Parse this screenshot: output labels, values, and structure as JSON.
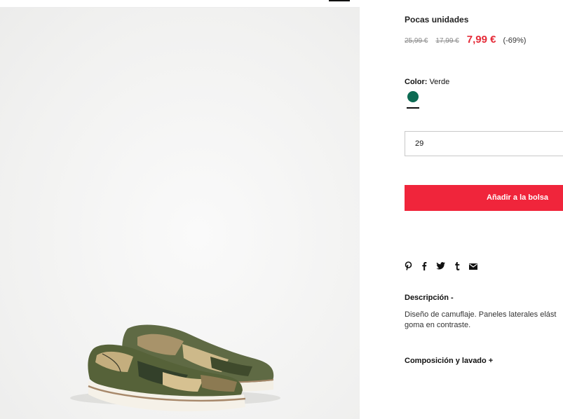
{
  "product": {
    "stock_label": "Pocas unidades",
    "prices": {
      "original": "25,99 €",
      "previous": "17,99 €",
      "current": "7,99 €",
      "discount": "(-69%)"
    },
    "color": {
      "label": "Color:",
      "value": "Verde",
      "swatch_hex": "#0d6b53"
    },
    "size": {
      "selected": "29"
    },
    "add_to_bag_label": "Añadir a la bolsa",
    "share_icons": [
      "pinterest-icon",
      "facebook-icon",
      "twitter-icon",
      "tumblr-icon",
      "email-icon"
    ],
    "description": {
      "title": "Descripción -",
      "lines": [
        "Diseño de camuflaje. Paneles laterales elást",
        "goma en contraste."
      ]
    },
    "composition_title": "Composición y lavado +"
  },
  "colors": {
    "accent": "#f0253b",
    "sale_price": "#e52b38"
  }
}
